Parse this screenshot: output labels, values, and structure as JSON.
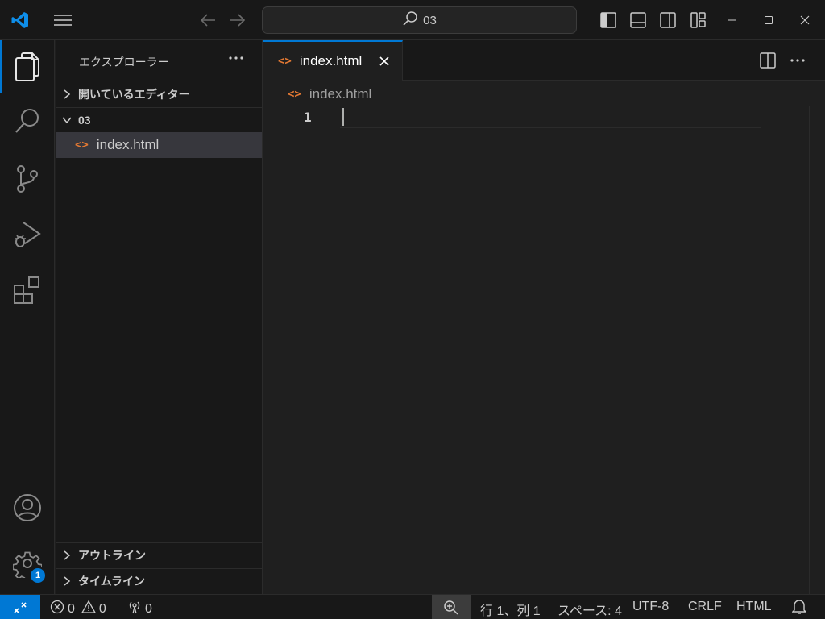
{
  "titlebar": {
    "search_text": "03",
    "icons": [
      "vscode-logo-icon",
      "menu-icon",
      "back-arrow-icon",
      "forward-arrow-icon",
      "search-icon",
      "toggle-primary-sidebar-icon",
      "toggle-panel-icon",
      "toggle-secondary-sidebar-icon",
      "customize-layout-icon",
      "minimize-icon",
      "maximize-icon",
      "close-icon"
    ]
  },
  "activitybar": {
    "items": [
      "explorer-icon",
      "search-icon",
      "source-control-icon",
      "run-debug-icon",
      "extensions-icon"
    ],
    "bottom": [
      "account-icon",
      "manage-gear-icon"
    ],
    "manage_badge": "1"
  },
  "sidebar": {
    "title": "エクスプローラー",
    "open_editors": "開いているエディター",
    "folder": "03",
    "file": "index.html",
    "outline": "アウトライン",
    "timeline": "タイムライン"
  },
  "editor": {
    "tab_label": "index.html",
    "breadcrumb": "index.html",
    "line_number": "1"
  },
  "statusbar": {
    "errors": "0",
    "warnings": "0",
    "ports": "0",
    "position": "行 1、列 1",
    "spaces": "スペース: 4",
    "encoding": "UTF-8",
    "eol": "CRLF",
    "language": "HTML"
  },
  "colors": {
    "accent": "#0078d4",
    "html_icon": "#e37933",
    "background": "#1f1f1f",
    "chrome": "#181818"
  }
}
